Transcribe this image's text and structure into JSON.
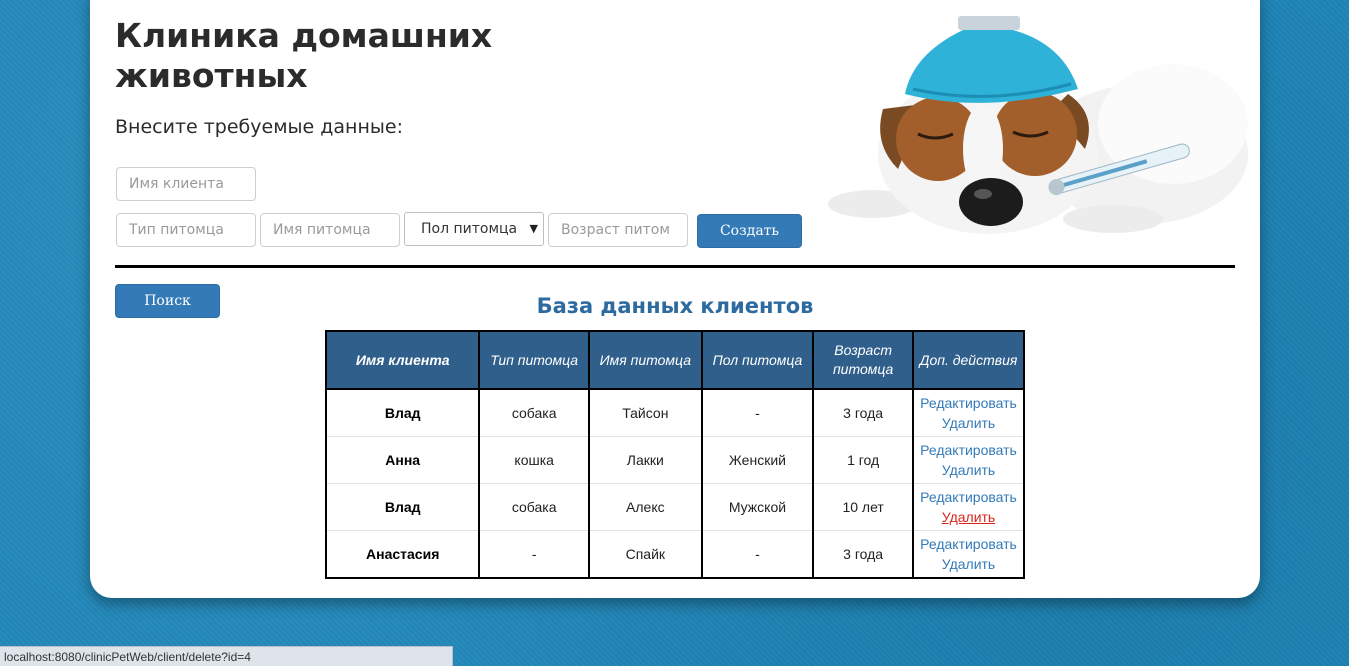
{
  "header": {
    "title": "Клиника домашних животных",
    "subtitle": "Внесите требуемые данные:"
  },
  "form": {
    "client_name_placeholder": "Имя клиента",
    "pet_type_placeholder": "Тип питомца",
    "pet_name_placeholder": "Имя питомца",
    "pet_gender_selected": "Пол питомца",
    "pet_age_placeholder": "Возраст питом",
    "create_label": "Создать"
  },
  "search": {
    "label": "Поиск"
  },
  "database": {
    "title": "База данных клиентов",
    "columns": [
      "Имя клиента",
      "Тип питомца",
      "Имя питомца",
      "Пол питомца",
      "Возраст питомца",
      "Доп. действия"
    ],
    "rows": [
      {
        "client": "Влад",
        "type": "собака",
        "pet": "Тайсон",
        "gender": "-",
        "age": "3 года",
        "edit": "Редактировать",
        "delete": "Удалить"
      },
      {
        "client": "Анна",
        "type": "кошка",
        "pet": "Лакки",
        "gender": "Женский",
        "age": "1 год",
        "edit": "Редактировать",
        "delete": "Удалить"
      },
      {
        "client": "Влад",
        "type": "собака",
        "pet": "Алекс",
        "gender": "Мужской",
        "age": "10 лет",
        "edit": "Редактировать",
        "delete": "Удалить"
      },
      {
        "client": "Анастасия",
        "type": "-",
        "pet": "Спайк",
        "gender": "-",
        "age": "3 года",
        "edit": "Редактировать",
        "delete": "Удалить"
      }
    ]
  },
  "status_bar": {
    "url": "localhost:8080/clinicPetWeb/client/delete?id=4"
  },
  "colors": {
    "background": "#1f86b8",
    "button": "#337ab7",
    "table_header": "#2f5f8a",
    "link": "#337ab7",
    "link_hover": "#d9251d"
  },
  "image": {
    "icon": "sick-dog-with-ice-pack-and-thermometer"
  }
}
